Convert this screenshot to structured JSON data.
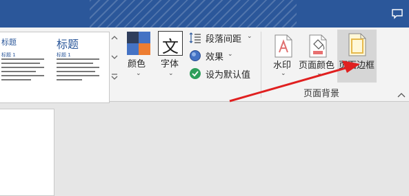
{
  "styles_gallery": {
    "items": [
      {
        "heading": "标题",
        "subheading": "标题 1"
      },
      {
        "heading": "标题",
        "subheading": "标题 1"
      }
    ]
  },
  "design": {
    "colors_label": "颜色",
    "fonts_label": "字体",
    "fonts_glyph": "文",
    "paragraph_spacing_label": "段落间距",
    "effects_label": "效果",
    "set_default_label": "设为默认值"
  },
  "page_background": {
    "watermark_label": "水印",
    "page_color_label": "页面颜色",
    "page_borders_label": "页面边框",
    "group_label": "页面背景"
  },
  "colors": {
    "title_bar": "#2b579a",
    "ribbon": "#f3f3f3",
    "arrow": "#e02020",
    "swatch_navy": "#2f3e5c",
    "swatch_blue": "#4472c4",
    "swatch_orange": "#ed7d31"
  }
}
